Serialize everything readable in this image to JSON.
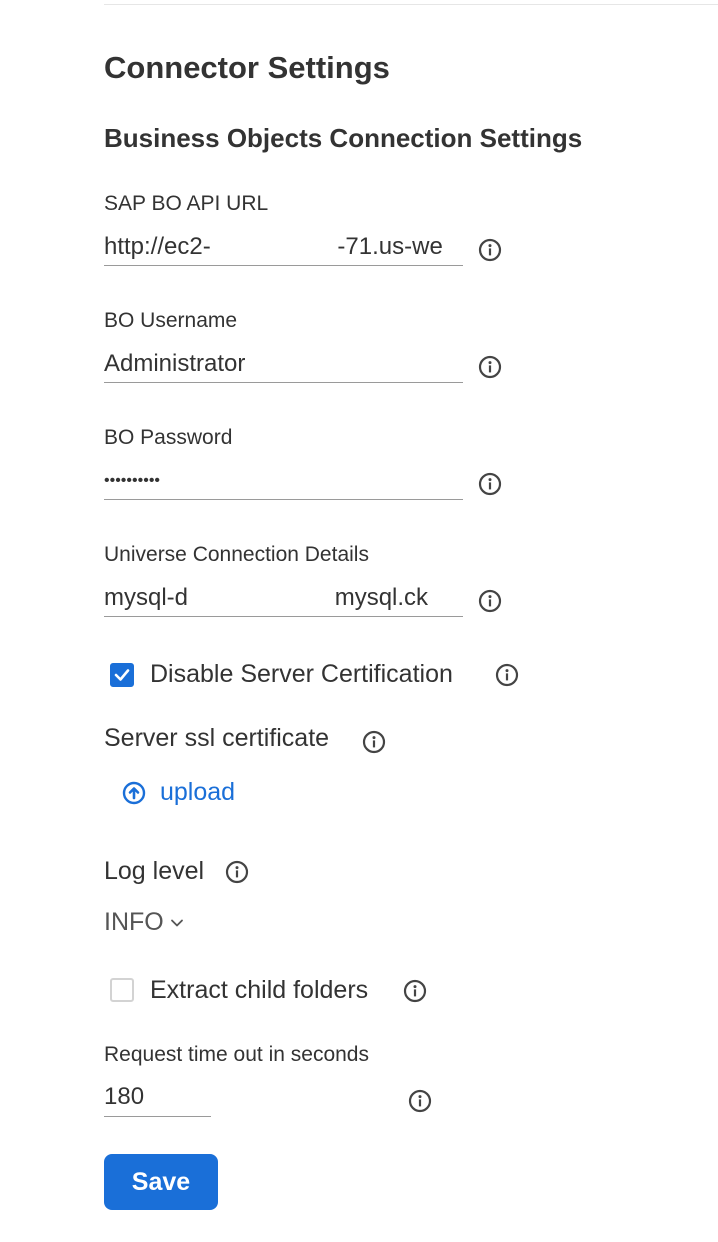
{
  "header": {
    "title": "Connector Settings",
    "section_title": "Business Objects Connection Settings"
  },
  "fields": {
    "api_url": {
      "label": "SAP BO API URL",
      "value": "http://ec2-                   -71.us-we",
      "info_icon": "info-icon"
    },
    "username": {
      "label": "BO Username",
      "value": "Administrator",
      "info_icon": "info-icon"
    },
    "password": {
      "label": "BO Password",
      "value": "••••••••••",
      "info_icon": "info-icon"
    },
    "universe": {
      "label": "Universe Connection Details",
      "value": "mysql-d                      mysql.ck",
      "info_icon": "info-icon"
    },
    "disable_cert": {
      "label": "Disable Server Certification",
      "checked": true
    },
    "ssl_cert": {
      "label": "Server ssl certificate",
      "upload_label": "upload"
    },
    "log_level": {
      "label": "Log level",
      "selected": "INFO"
    },
    "extract_child": {
      "label": "Extract child folders",
      "checked": false
    },
    "timeout": {
      "label": "Request time out in seconds",
      "value": "180"
    }
  },
  "actions": {
    "save_label": "Save"
  },
  "colors": {
    "accent": "#1a6fd8",
    "text": "#333333",
    "underline": "#9a9a9a"
  }
}
